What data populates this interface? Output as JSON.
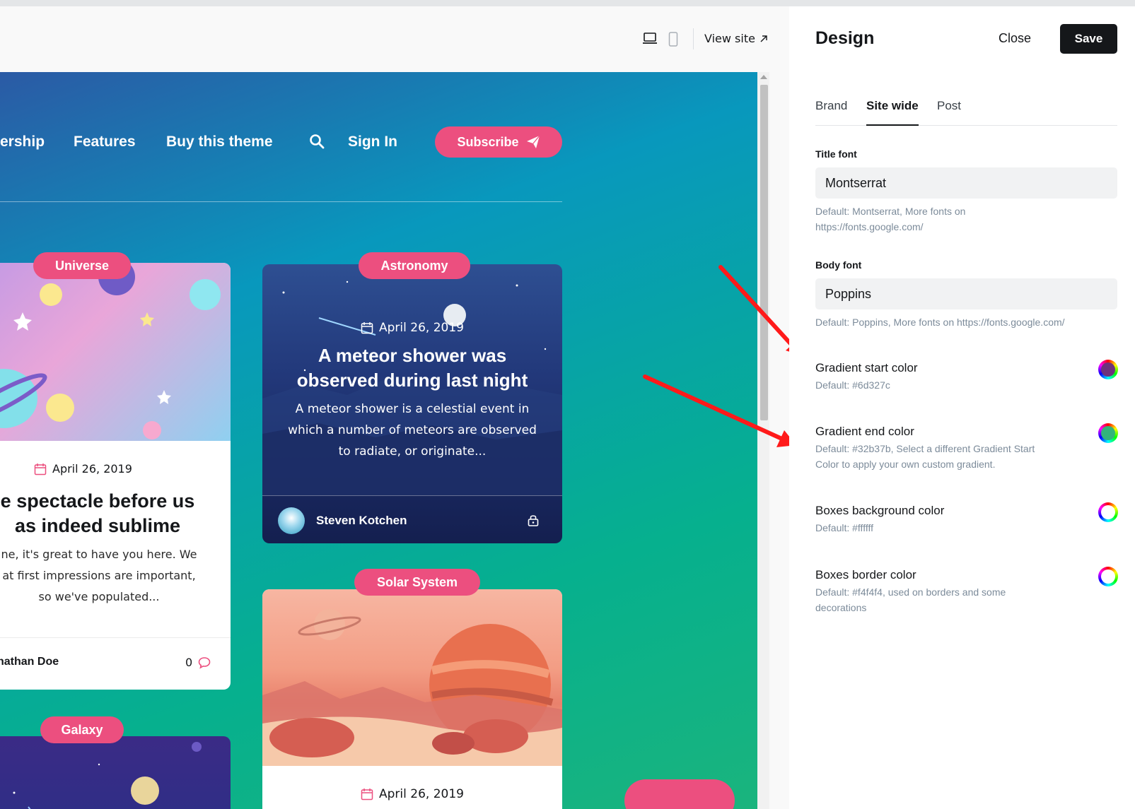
{
  "preview": {
    "view_site_label": "View site",
    "nav": {
      "items": [
        "ership",
        "Features",
        "Buy this theme",
        "Sign In"
      ],
      "subscribe_label": "Subscribe"
    },
    "cards": [
      {
        "tag": "Universe",
        "date": "April 26, 2019",
        "title_line1": "e spectacle before us",
        "title_line2": "as indeed sublime",
        "excerpt_line1": "ne, it's great to have you here. We",
        "excerpt_line2": "at first impressions are important,",
        "excerpt_line3": "so we've populated...",
        "author": "nathan Doe",
        "comment_count": "0"
      },
      {
        "tag": "Astronomy",
        "date": "April 26, 2019",
        "title_line1": "A meteor shower was",
        "title_line2": "observed during last night",
        "excerpt_line1": "A meteor shower is a celestial event in",
        "excerpt_line2": "which a number of meteors are observed",
        "excerpt_line3": "to radiate, or originate...",
        "author": "Steven Kotchen"
      },
      {
        "tag": "Solar System",
        "date": "April 26, 2019"
      },
      {
        "tag": "Galaxy"
      }
    ]
  },
  "panel": {
    "title": "Design",
    "close_label": "Close",
    "save_label": "Save",
    "tabs": [
      {
        "label": "Brand",
        "active": false
      },
      {
        "label": "Site wide",
        "active": true
      },
      {
        "label": "Post",
        "active": false
      }
    ],
    "title_font": {
      "label": "Title font",
      "value": "Montserrat",
      "hint_line1": "Default: Montserrat, More fonts on",
      "hint_line2": "https://fonts.google.com/"
    },
    "body_font": {
      "label": "Body font",
      "value": "Poppins",
      "hint": "Default: Poppins, More fonts on https://fonts.google.com/"
    },
    "colors": [
      {
        "name": "Gradient start color",
        "hint_line1": "Default: #6d327c",
        "hint_line2": "",
        "value": "#6d327c"
      },
      {
        "name": "Gradient end color",
        "hint_line1": "Default: #32b37b, Select a different Gradient Start",
        "hint_line2": "Color to apply your own custom gradient.",
        "value": "#32b37b"
      },
      {
        "name": "Boxes background color",
        "hint_line1": "Default: #ffffff",
        "hint_line2": "",
        "value": "#ffffff"
      },
      {
        "name": "Boxes border color",
        "hint_line1": "Default: #f4f4f4, used on borders and some",
        "hint_line2": "decorations",
        "value": "#f4f4f4"
      }
    ]
  },
  "colors": {
    "accent_pink": "#ec4f7f",
    "dark": "#15171a",
    "annotation_arrow": "#ff1a1a"
  }
}
